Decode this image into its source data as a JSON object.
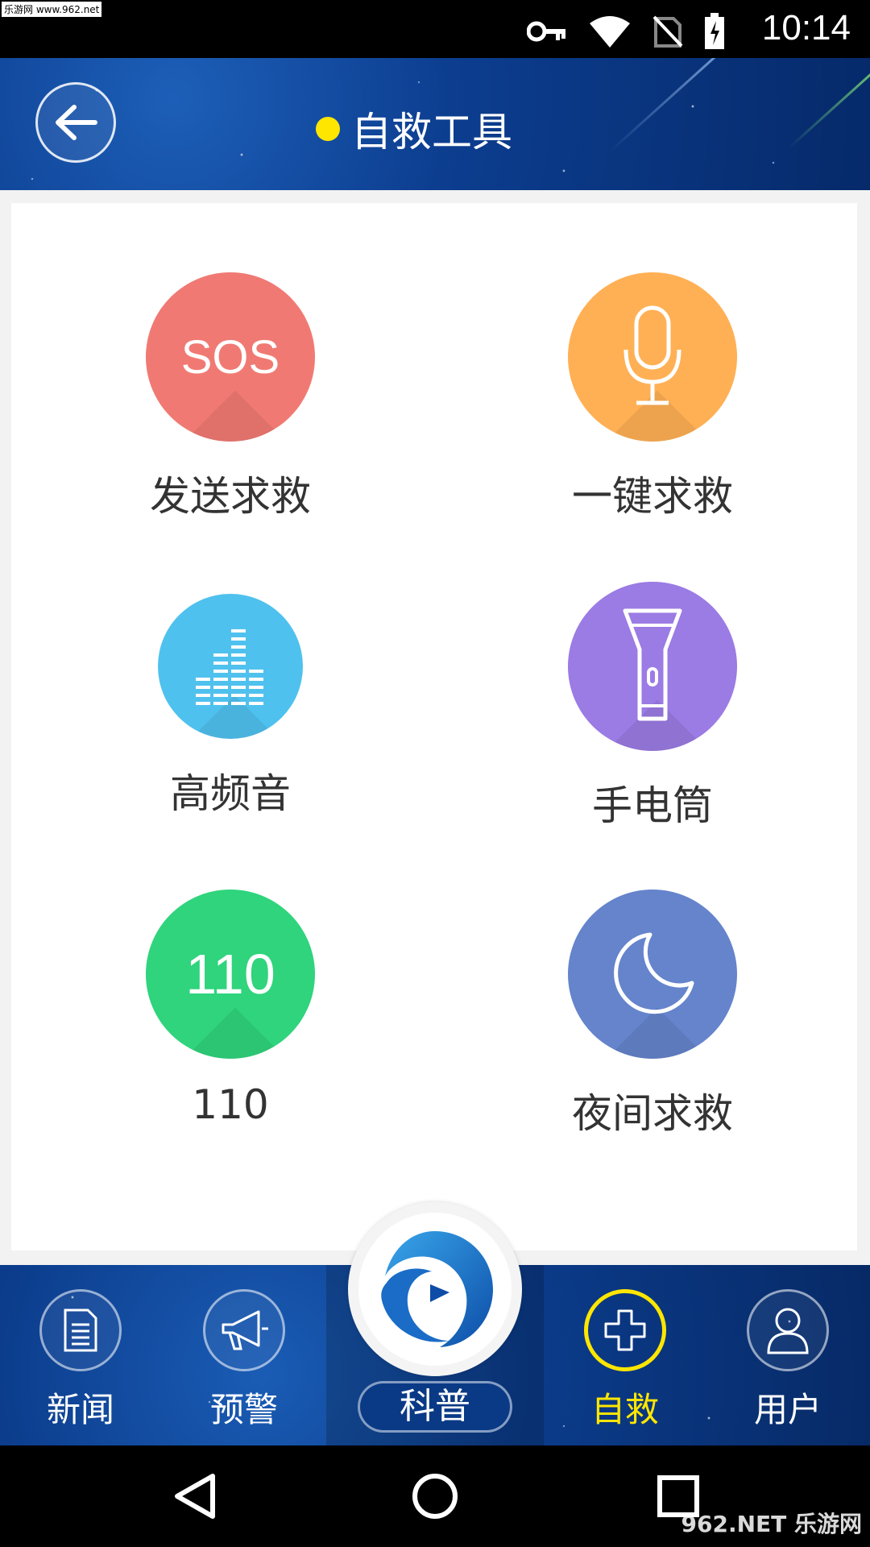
{
  "watermark_top": "乐游网 www.962.net",
  "status": {
    "time": "10:14"
  },
  "header": {
    "title": "自救工具",
    "back_icon": "arrow-left-icon"
  },
  "tools": [
    {
      "id": "sos",
      "label": "发送求救",
      "icon_text": "SOS",
      "color": "#f07a73"
    },
    {
      "id": "voice",
      "label": "一键求救",
      "icon": "microphone-icon",
      "color": "#ffb054"
    },
    {
      "id": "highfreq",
      "label": "高频音",
      "icon": "equalizer-icon",
      "color": "#4fc1ee"
    },
    {
      "id": "flashlight",
      "label": "手电筒",
      "icon": "flashlight-icon",
      "color": "#9b7be4"
    },
    {
      "id": "police",
      "label": "110",
      "icon_text": "110",
      "color": "#2fd47c"
    },
    {
      "id": "night",
      "label": "夜间求救",
      "icon": "moon-icon",
      "color": "#6584cc"
    }
  ],
  "bottom_nav": {
    "items": [
      {
        "label": "新闻",
        "icon": "document-icon",
        "active": false
      },
      {
        "label": "预警",
        "icon": "megaphone-icon",
        "active": false
      },
      {
        "label": "科普",
        "icon": "logo-icon",
        "active": false
      },
      {
        "label": "自救",
        "icon": "plus-icon",
        "active": true
      },
      {
        "label": "用户",
        "icon": "user-icon",
        "active": false
      }
    ],
    "active_color": "#ffe600"
  },
  "watermark_bottom": "962.NET 乐游网"
}
